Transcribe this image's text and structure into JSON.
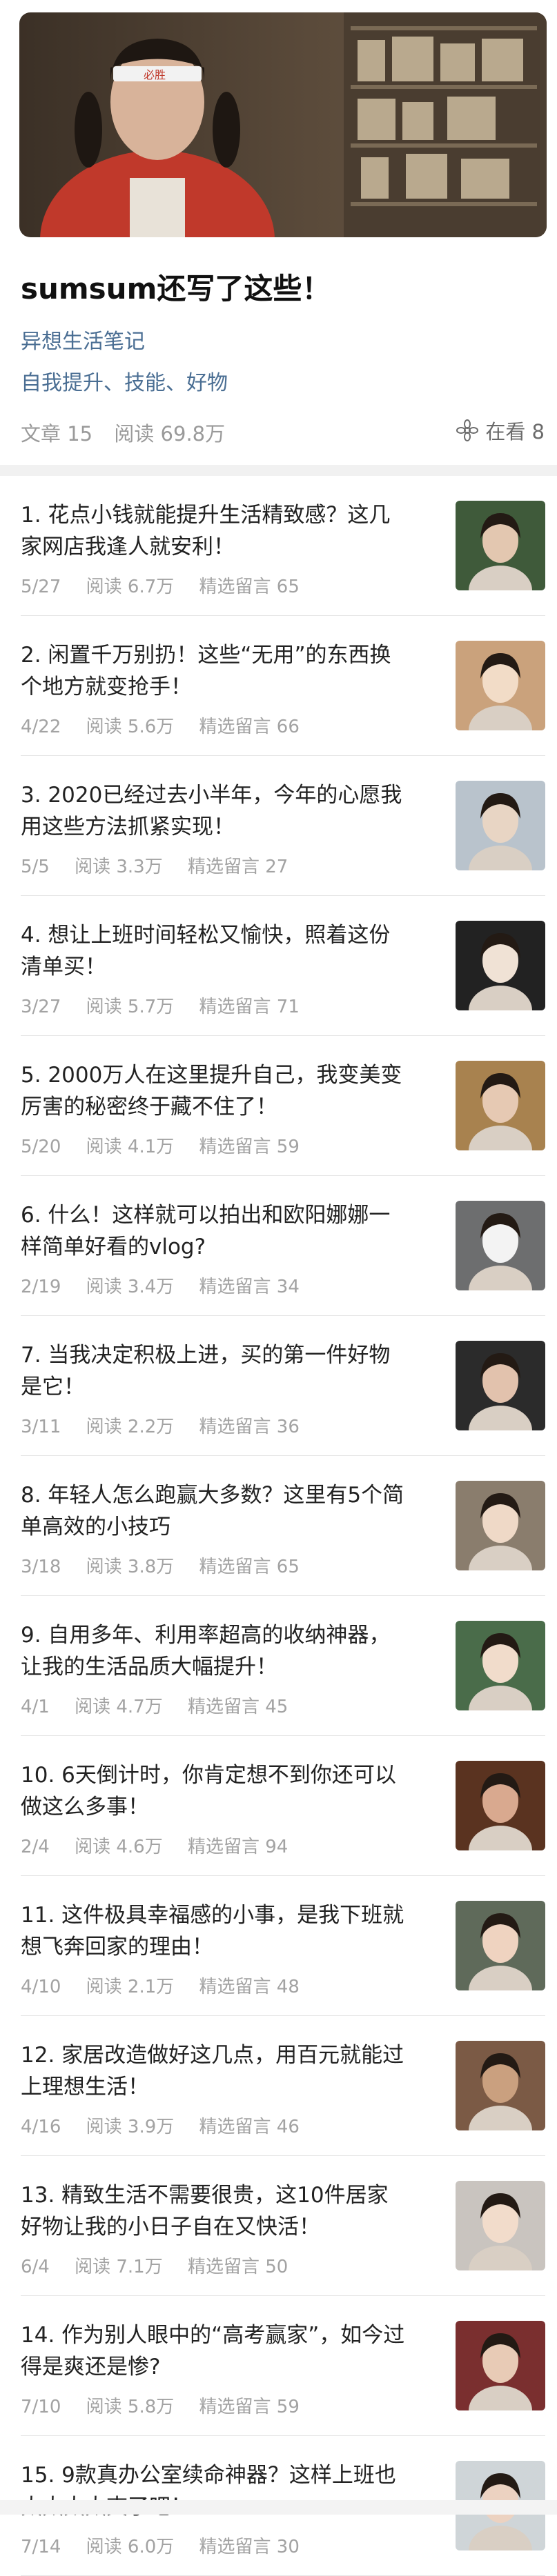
{
  "header": {
    "title": "sumsum还写了这些！",
    "author": "异想生活笔记",
    "tags": "自我提升、技能、好物",
    "stats": {
      "articles": "文章 15",
      "reads": "阅读 69.8万"
    },
    "watching": "在看 8"
  },
  "articles": [
    {
      "line1": "1. 花点小钱就能提升生活精致感？这几",
      "line2": "家网店我逢人就安利！",
      "date": "5/27",
      "reads": "阅读 6.7万",
      "comments": "精选留言 65",
      "thumb": "thumb-1"
    },
    {
      "line1": "2. 闲置千万别扔！这些“无用”的东西换",
      "line2": "个地方就变抢手！",
      "date": "4/22",
      "reads": "阅读 5.6万",
      "comments": "精选留言 66",
      "thumb": "thumb-2"
    },
    {
      "line1": "3. 2020已经过去小半年，今年的心愿我",
      "line2": "用这些方法抓紧实现！",
      "date": "5/5",
      "reads": "阅读 3.3万",
      "comments": "精选留言 27",
      "thumb": "thumb-3"
    },
    {
      "line1": "4. 想让上班时间轻松又愉快，照着这份",
      "line2": "清单买！",
      "date": "3/27",
      "reads": "阅读 5.7万",
      "comments": "精选留言 71",
      "thumb": "thumb-4"
    },
    {
      "line1": "5. 2000万人在这里提升自己，我变美变",
      "line2": "厉害的秘密终于藏不住了！",
      "date": "5/20",
      "reads": "阅读 4.1万",
      "comments": "精选留言 59",
      "thumb": "thumb-5"
    },
    {
      "line1": "6. 什么！这样就可以拍出和欧阳娜娜一",
      "line2": "样简单好看的vlog?",
      "date": "2/19",
      "reads": "阅读 3.4万",
      "comments": "精选留言 34",
      "thumb": "thumb-6"
    },
    {
      "line1": "7. 当我决定积极上进，买的第一件好物",
      "line2": "是它！",
      "date": "3/11",
      "reads": "阅读 2.2万",
      "comments": "精选留言 36",
      "thumb": "thumb-7"
    },
    {
      "line1": "8. 年轻人怎么跑赢大多数？这里有5个简",
      "line2": "单高效的小技巧",
      "date": "3/18",
      "reads": "阅读 3.8万",
      "comments": "精选留言 65",
      "thumb": "thumb-8"
    },
    {
      "line1": "9. 自用多年、利用率超高的收纳神器，",
      "line2": "让我的生活品质大幅提升！",
      "date": "4/1",
      "reads": "阅读 4.7万",
      "comments": "精选留言 45",
      "thumb": "thumb-9"
    },
    {
      "line1": "10. 6天倒计时，你肯定想不到你还可以",
      "line2": "做这么多事！",
      "date": "2/4",
      "reads": "阅读 4.6万",
      "comments": "精选留言 94",
      "thumb": "thumb-10"
    },
    {
      "line1": "11. 这件极具幸福感的小事，是我下班就",
      "line2": "想飞奔回家的理由！",
      "date": "4/10",
      "reads": "阅读 2.1万",
      "comments": "精选留言 48",
      "thumb": "thumb-11"
    },
    {
      "line1": "12. 家居改造做好这几点，用百元就能过",
      "line2": "上理想生活！",
      "date": "4/16",
      "reads": "阅读 3.9万",
      "comments": "精选留言 46",
      "thumb": "thumb-12"
    },
    {
      "line1": "13. 精致生活不需要很贵，这10件居家",
      "line2": "好物让我的小日子自在又快活！",
      "date": "6/4",
      "reads": "阅读 7.1万",
      "comments": "精选留言 50",
      "thumb": "thumb-13"
    },
    {
      "line1": "14. 作为别人眼中的“高考赢家”，如今过",
      "line2": "得是爽还是惨?",
      "date": "7/10",
      "reads": "阅读 5.8万",
      "comments": "精选留言 59",
      "thumb": "thumb-14"
    },
    {
      "line1": "15. 9款真办公室续命神器？这样上班也",
      "line2": "太太太太爽了吧！",
      "date": "7/14",
      "reads": "阅读 6.0万",
      "comments": "精选留言 30",
      "thumb": "thumb-15"
    }
  ],
  "colors": {
    "link": "#4a6e93",
    "meta": "#a3a3a3",
    "separator": "#f1f1f1"
  }
}
